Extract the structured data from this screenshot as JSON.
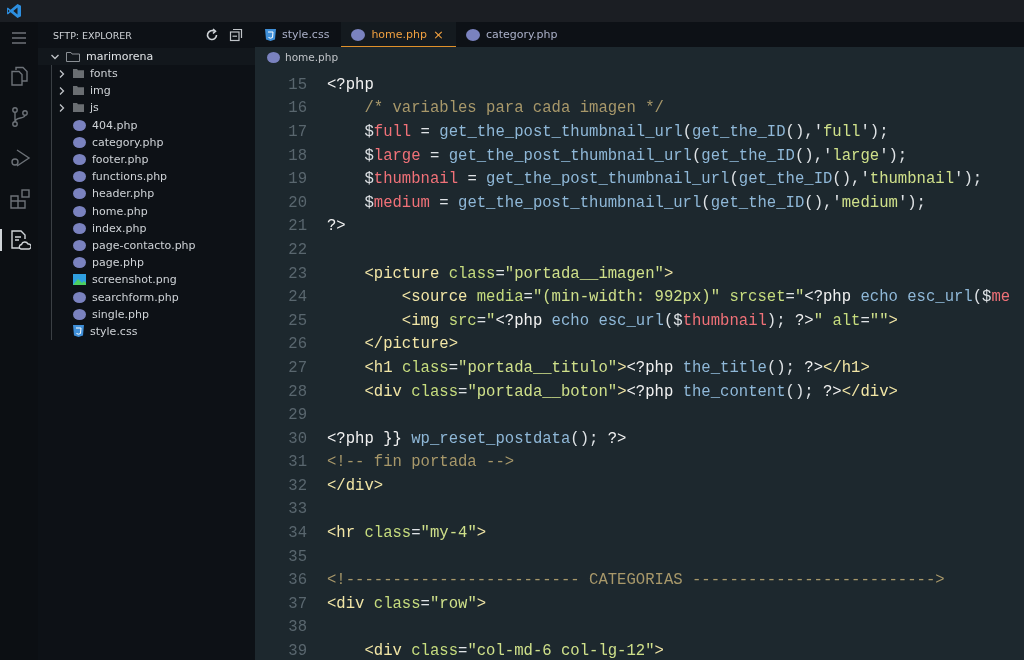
{
  "activity_bar": [
    {
      "kind": "files",
      "selected": false
    },
    {
      "kind": "branch",
      "selected": false
    },
    {
      "kind": "debug",
      "selected": false
    },
    {
      "kind": "extensions",
      "selected": false
    },
    {
      "kind": "sftp",
      "selected": true
    }
  ],
  "sidebar": {
    "title": "SFTP: EXPLORER",
    "root": {
      "name": "marimorena",
      "expanded": true,
      "children": [
        {
          "kind": "folder",
          "name": "fonts",
          "expanded": false
        },
        {
          "kind": "folder",
          "name": "img",
          "expanded": false
        },
        {
          "kind": "folder",
          "name": "js",
          "expanded": false
        },
        {
          "kind": "php",
          "name": "404.php"
        },
        {
          "kind": "php",
          "name": "category.php"
        },
        {
          "kind": "php",
          "name": "footer.php"
        },
        {
          "kind": "php",
          "name": "functions.php"
        },
        {
          "kind": "php",
          "name": "header.php"
        },
        {
          "kind": "php",
          "name": "home.php"
        },
        {
          "kind": "php",
          "name": "index.php"
        },
        {
          "kind": "php",
          "name": "page-contacto.php"
        },
        {
          "kind": "php",
          "name": "page.php"
        },
        {
          "kind": "image",
          "name": "screenshot.png"
        },
        {
          "kind": "php",
          "name": "searchform.php"
        },
        {
          "kind": "php",
          "name": "single.php"
        },
        {
          "kind": "css",
          "name": "style.css"
        }
      ]
    }
  },
  "tabs": [
    {
      "kind": "css",
      "label": "style.css",
      "selected": false
    },
    {
      "kind": "php",
      "label": "home.php",
      "selected": true,
      "close": "×"
    },
    {
      "kind": "php",
      "label": "category.php",
      "selected": false
    }
  ],
  "breadcrumb": {
    "kind": "php",
    "label": "home.php"
  },
  "code": [
    {
      "number": "15",
      "tokens": [
        {
          "kind": "kw",
          "text": "<?php"
        }
      ]
    },
    {
      "number": "16",
      "tokens": [
        {
          "kind": "comment",
          "text": "    /* variables para cada imagen */"
        }
      ]
    },
    {
      "number": "17",
      "tokens": [
        {
          "kind": "plain",
          "text": "    $"
        },
        {
          "kind": "var",
          "text": "full"
        },
        {
          "kind": "plain",
          "text": " = "
        },
        {
          "kind": "func",
          "text": "get_the_post_thumbnail_url"
        },
        {
          "kind": "plain",
          "text": "("
        },
        {
          "kind": "func",
          "text": "get_the_ID"
        },
        {
          "kind": "plain",
          "text": "(),'"
        },
        {
          "kind": "str",
          "text": "full"
        },
        {
          "kind": "plain",
          "text": "');"
        }
      ]
    },
    {
      "number": "18",
      "tokens": [
        {
          "kind": "plain",
          "text": "    $"
        },
        {
          "kind": "var",
          "text": "large"
        },
        {
          "kind": "plain",
          "text": " = "
        },
        {
          "kind": "func",
          "text": "get_the_post_thumbnail_url"
        },
        {
          "kind": "plain",
          "text": "("
        },
        {
          "kind": "func",
          "text": "get_the_ID"
        },
        {
          "kind": "plain",
          "text": "(),'"
        },
        {
          "kind": "str",
          "text": "large"
        },
        {
          "kind": "plain",
          "text": "');"
        }
      ]
    },
    {
      "number": "19",
      "tokens": [
        {
          "kind": "plain",
          "text": "    $"
        },
        {
          "kind": "var",
          "text": "thumbnail"
        },
        {
          "kind": "plain",
          "text": " = "
        },
        {
          "kind": "func",
          "text": "get_the_post_thumbnail_url"
        },
        {
          "kind": "plain",
          "text": "("
        },
        {
          "kind": "func",
          "text": "get_the_ID"
        },
        {
          "kind": "plain",
          "text": "(),'"
        },
        {
          "kind": "str",
          "text": "thumbnail"
        },
        {
          "kind": "plain",
          "text": "');"
        }
      ]
    },
    {
      "number": "20",
      "tokens": [
        {
          "kind": "plain",
          "text": "    $"
        },
        {
          "kind": "var",
          "text": "medium"
        },
        {
          "kind": "plain",
          "text": " = "
        },
        {
          "kind": "func",
          "text": "get_the_post_thumbnail_url"
        },
        {
          "kind": "plain",
          "text": "("
        },
        {
          "kind": "func",
          "text": "get_the_ID"
        },
        {
          "kind": "plain",
          "text": "(),'"
        },
        {
          "kind": "str",
          "text": "medium"
        },
        {
          "kind": "plain",
          "text": "');"
        }
      ]
    },
    {
      "number": "21",
      "tokens": [
        {
          "kind": "kw",
          "text": "?>"
        }
      ]
    },
    {
      "number": "22"
    },
    {
      "number": "23",
      "tokens": [
        {
          "kind": "tag",
          "text": "    <picture "
        },
        {
          "kind": "attr",
          "text": "class"
        },
        {
          "kind": "plain",
          "text": "="
        },
        {
          "kind": "str",
          "text": "\"portada__imagen\""
        },
        {
          "kind": "tag",
          "text": ">"
        }
      ]
    },
    {
      "number": "24",
      "tokens": [
        {
          "kind": "tag",
          "text": "        <source "
        },
        {
          "kind": "attr",
          "text": "media"
        },
        {
          "kind": "plain",
          "text": "="
        },
        {
          "kind": "str",
          "text": "\"(min-width: 992px)\" "
        },
        {
          "kind": "attr",
          "text": "srcset"
        },
        {
          "kind": "plain",
          "text": "="
        },
        {
          "kind": "str",
          "text": "\""
        },
        {
          "kind": "kw",
          "text": "<?php "
        },
        {
          "kind": "func",
          "text": "echo esc_url"
        },
        {
          "kind": "plain",
          "text": "($"
        },
        {
          "kind": "var",
          "text": "me"
        }
      ]
    },
    {
      "number": "25",
      "tokens": [
        {
          "kind": "tag",
          "text": "        <img "
        },
        {
          "kind": "attr",
          "text": "src"
        },
        {
          "kind": "plain",
          "text": "="
        },
        {
          "kind": "str",
          "text": "\""
        },
        {
          "kind": "kw",
          "text": "<?php "
        },
        {
          "kind": "func",
          "text": "echo esc_url"
        },
        {
          "kind": "plain",
          "text": "($"
        },
        {
          "kind": "var",
          "text": "thumbnail"
        },
        {
          "kind": "plain",
          "text": "); "
        },
        {
          "kind": "kw",
          "text": "?>"
        },
        {
          "kind": "str",
          "text": "\" "
        },
        {
          "kind": "attr",
          "text": "alt"
        },
        {
          "kind": "plain",
          "text": "="
        },
        {
          "kind": "str",
          "text": "\"\""
        },
        {
          "kind": "tag",
          "text": ">"
        }
      ]
    },
    {
      "number": "26",
      "tokens": [
        {
          "kind": "tag",
          "text": "    </picture>"
        }
      ]
    },
    {
      "number": "27",
      "tokens": [
        {
          "kind": "tag",
          "text": "    <h1 "
        },
        {
          "kind": "attr",
          "text": "class"
        },
        {
          "kind": "plain",
          "text": "="
        },
        {
          "kind": "str",
          "text": "\"portada__titulo\""
        },
        {
          "kind": "tag",
          "text": ">"
        },
        {
          "kind": "kw",
          "text": "<?php "
        },
        {
          "kind": "func",
          "text": "the_title"
        },
        {
          "kind": "plain",
          "text": "(); "
        },
        {
          "kind": "kw",
          "text": "?>"
        },
        {
          "kind": "tag",
          "text": "</h1>"
        }
      ]
    },
    {
      "number": "28",
      "tokens": [
        {
          "kind": "tag",
          "text": "    <div "
        },
        {
          "kind": "attr",
          "text": "class"
        },
        {
          "kind": "plain",
          "text": "="
        },
        {
          "kind": "str",
          "text": "\"portada__boton\""
        },
        {
          "kind": "tag",
          "text": ">"
        },
        {
          "kind": "kw",
          "text": "<?php "
        },
        {
          "kind": "func",
          "text": "the_content"
        },
        {
          "kind": "plain",
          "text": "(); "
        },
        {
          "kind": "kw",
          "text": "?>"
        },
        {
          "kind": "tag",
          "text": "</div>"
        }
      ]
    },
    {
      "number": "29"
    },
    {
      "number": "30",
      "tokens": [
        {
          "kind": "kw",
          "text": "<?php }} "
        },
        {
          "kind": "func",
          "text": "wp_reset_postdata"
        },
        {
          "kind": "plain",
          "text": "(); "
        },
        {
          "kind": "kw",
          "text": "?>"
        }
      ]
    },
    {
      "number": "31",
      "tokens": [
        {
          "kind": "comment",
          "text": "<!-- fin portada -->"
        }
      ]
    },
    {
      "number": "32",
      "tokens": [
        {
          "kind": "tag",
          "text": "</div>"
        }
      ]
    },
    {
      "number": "33"
    },
    {
      "number": "34",
      "tokens": [
        {
          "kind": "tag",
          "text": "<hr "
        },
        {
          "kind": "attr",
          "text": "class"
        },
        {
          "kind": "plain",
          "text": "="
        },
        {
          "kind": "str",
          "text": "\"my-4\""
        },
        {
          "kind": "tag",
          "text": ">"
        }
      ]
    },
    {
      "number": "35"
    },
    {
      "number": "36",
      "tokens": [
        {
          "kind": "comment",
          "text": "<!------------------------- CATEGORIAS -------------------------->"
        }
      ]
    },
    {
      "number": "37",
      "tokens": [
        {
          "kind": "tag",
          "text": "<div "
        },
        {
          "kind": "attr",
          "text": "class"
        },
        {
          "kind": "plain",
          "text": "="
        },
        {
          "kind": "str",
          "text": "\"row\""
        },
        {
          "kind": "tag",
          "text": ">"
        }
      ]
    },
    {
      "number": "38"
    },
    {
      "number": "39",
      "tokens": [
        {
          "kind": "tag",
          "text": "    <div "
        },
        {
          "kind": "attr",
          "text": "class"
        },
        {
          "kind": "plain",
          "text": "="
        },
        {
          "kind": "str",
          "text": "\"col-md-6 col-lg-12\""
        },
        {
          "kind": "tag",
          "text": ">"
        }
      ]
    }
  ]
}
